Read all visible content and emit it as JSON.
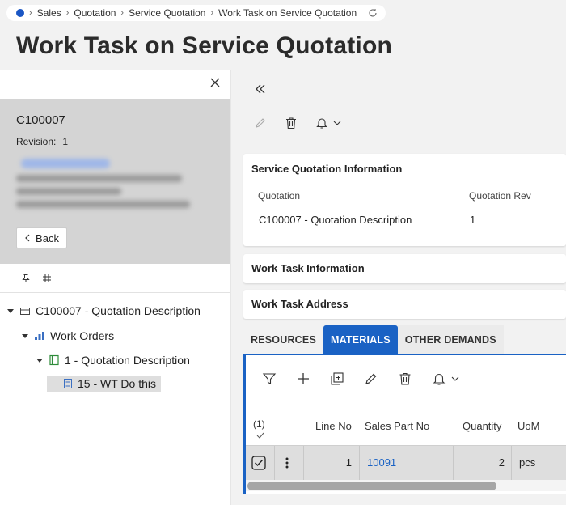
{
  "breadcrumb": {
    "items": [
      "Sales",
      "Quotation",
      "Service Quotation",
      "Work Task on Service Quotation"
    ]
  },
  "page_title": "Work Task on Service Quotation",
  "left_panel": {
    "card": {
      "id": "C100007",
      "revision_label": "Revision:",
      "revision_value": "1"
    },
    "back_label": "Back",
    "tree": [
      {
        "label": "C100007 -  Quotation Description",
        "icon": "quotation-icon",
        "level": 0
      },
      {
        "label": "Work Orders",
        "icon": "work-orders-icon",
        "level": 1
      },
      {
        "label": "1 -  Quotation Description",
        "icon": "work-order-icon",
        "level": 2
      },
      {
        "label": "15 - WT Do this",
        "icon": "work-task-icon",
        "level": 3,
        "selected": true
      }
    ]
  },
  "service_quotation_info": {
    "title": "Service Quotation Information",
    "fields": [
      {
        "label": "Quotation",
        "value": "C100007 -  Quotation Description"
      },
      {
        "label": "Quotation Rev",
        "value": "1"
      }
    ]
  },
  "work_task_info": {
    "title": "Work Task Information"
  },
  "work_task_address": {
    "title": "Work Task Address"
  },
  "tabs": [
    {
      "label": "RESOURCES",
      "active": false
    },
    {
      "label": "MATERIALS",
      "active": true
    },
    {
      "label": "OTHER DEMANDS",
      "active": false
    }
  ],
  "materials": {
    "selection_count": "(1)",
    "columns": [
      "Line No",
      "Sales Part No",
      "Quantity",
      "UoM"
    ],
    "rows": [
      {
        "line_no": "1",
        "sales_part_no": "10091",
        "quantity": "2",
        "uom": "pcs",
        "checked": true
      }
    ]
  },
  "colors": {
    "accent": "#1a62c4",
    "link": "#1a62c4",
    "background": "#f2f2f2"
  }
}
